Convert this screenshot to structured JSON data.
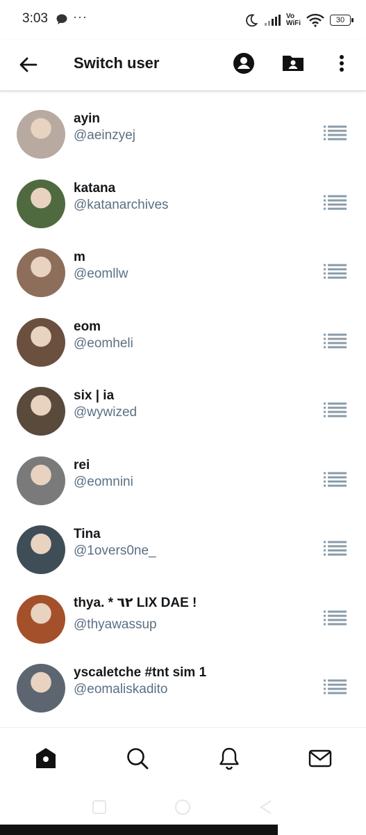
{
  "status_bar": {
    "time": "3:03",
    "dots": "···",
    "network": [
      "Vo",
      "WiFi"
    ],
    "battery": "30"
  },
  "app_bar": {
    "title": "Switch user"
  },
  "accounts": [
    {
      "name": "ayin",
      "handle": "@aeinzyej",
      "avatar_color": "#b8aaa0"
    },
    {
      "name": "katana",
      "handle": "@katanarchives",
      "avatar_color": "#4f6a3f"
    },
    {
      "name": "m",
      "handle": "@eomllw",
      "avatar_color": "#8d6e5a"
    },
    {
      "name": "eom",
      "handle": "@eomheli",
      "avatar_color": "#6b4f3f"
    },
    {
      "name": "six | ia",
      "handle": "@wywized",
      "avatar_color": "#5a4a3c"
    },
    {
      "name": "rei",
      "handle": "@eomnini",
      "avatar_color": "#7a7a7a"
    },
    {
      "name": "Tina",
      "handle": "@1overs0ne_",
      "avatar_color": "#3f4d56"
    },
    {
      "name": "thya. * ٦٢ LIX DAE !",
      "handle": "@thyawassup",
      "avatar_color": "#a4502a"
    },
    {
      "name": "yscaletche #tnt sim 1",
      "handle": "@eomaliskadito",
      "avatar_color": "#5d6670"
    }
  ],
  "colors": {
    "text_primary": "#14171a",
    "text_secondary": "#5b7083",
    "icon": "#111111",
    "drag_handle": "#8a9ba8"
  },
  "bottom_nav": [
    "home-icon",
    "search-icon",
    "notifications-icon",
    "messages-icon"
  ]
}
